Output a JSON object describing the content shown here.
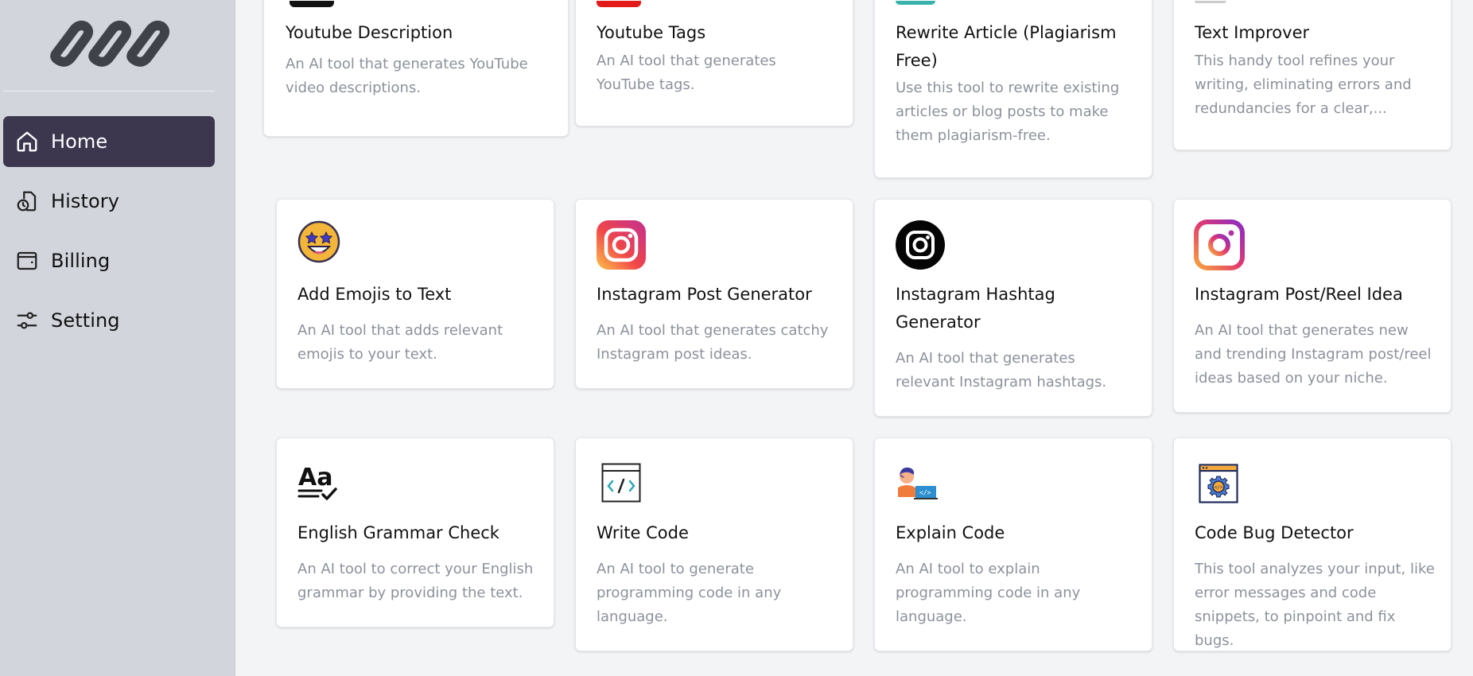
{
  "sidebar": {
    "nav": [
      {
        "label": "Home",
        "icon": "home-icon",
        "active": true
      },
      {
        "label": "History",
        "icon": "history-icon",
        "active": false
      },
      {
        "label": "Billing",
        "icon": "wallet-icon",
        "active": false
      },
      {
        "label": "Setting",
        "icon": "settings-sliders-icon",
        "active": false
      }
    ]
  },
  "colors": {
    "sidebar_bg": "#d2d5dc",
    "active_nav_bg": "#3c374f",
    "page_bg": "#f3f4f6",
    "desc_text": "#8c919c"
  },
  "tools": [
    {
      "title": "Youtube Description",
      "desc": "An AI tool that generates YouTube video descriptions.",
      "icon": "youtube-icon"
    },
    {
      "title": "Youtube Tags",
      "desc": "An AI tool that generates YouTube tags.",
      "icon": "youtube-icon"
    },
    {
      "title": "Rewrite Article (Plagiarism Free)",
      "desc": "Use this tool to rewrite existing articles or blog posts to make them plagiarism-free.",
      "icon": "rewrite-icon"
    },
    {
      "title": "Text Improver",
      "desc": "This handy tool refines your writing, eliminating errors and redundancies for a clear,...",
      "icon": "text-improver-icon"
    },
    {
      "title": "Add Emojis to Text",
      "desc": "An AI tool that adds relevant emojis to your text.",
      "icon": "star-eyes-emoji-icon"
    },
    {
      "title": "Instagram Post Generator",
      "desc": "An AI tool that generates catchy Instagram post ideas.",
      "icon": "instagram-icon"
    },
    {
      "title": "Instagram Hashtag Generator",
      "desc": "An AI tool that generates relevant Instagram hashtags.",
      "icon": "instagram-black-icon"
    },
    {
      "title": "Instagram Post/Reel Idea",
      "desc": "An AI tool that generates new and trending Instagram post/reel ideas based on your niche.",
      "icon": "instagram-icon"
    },
    {
      "title": "English Grammar Check",
      "desc": "An AI tool to correct your English grammar by providing the text.",
      "icon": "grammar-check-icon"
    },
    {
      "title": "Write Code",
      "desc": "An AI tool to generate programming code in any language.",
      "icon": "code-window-icon"
    },
    {
      "title": "Explain Code",
      "desc": "An AI tool to explain programming code in any language.",
      "icon": "developer-icon"
    },
    {
      "title": "Code Bug Detector",
      "desc": "This tool analyzes your input, like error messages and code snippets, to pinpoint and fix bugs.",
      "icon": "bug-detector-icon"
    }
  ]
}
